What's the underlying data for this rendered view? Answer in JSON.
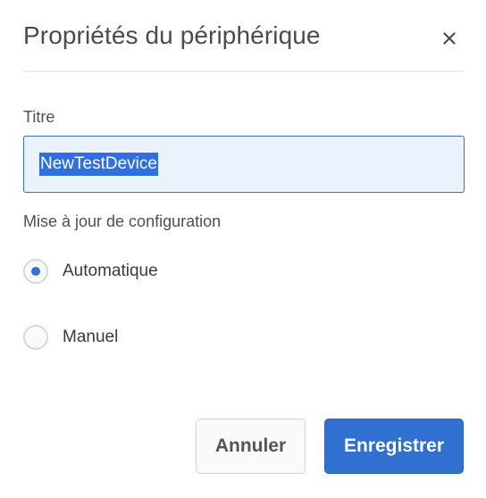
{
  "dialog": {
    "title": "Propriétés du périphérique",
    "close_icon": "close-icon"
  },
  "title_field": {
    "label": "Titre",
    "value": "NewTestDevice",
    "text_selected": true
  },
  "config_update": {
    "label": "Mise à jour de configuration",
    "options": [
      {
        "label": "Automatique",
        "selected": true
      },
      {
        "label": "Manuel",
        "selected": false
      }
    ]
  },
  "buttons": {
    "cancel_label": "Annuler",
    "save_label": "Enregistrer"
  },
  "colors": {
    "accent": "#2f6fde",
    "primary_button": "#3070d0",
    "selection_highlight": "#2f6fde",
    "input_background": "#e9f2fd"
  }
}
